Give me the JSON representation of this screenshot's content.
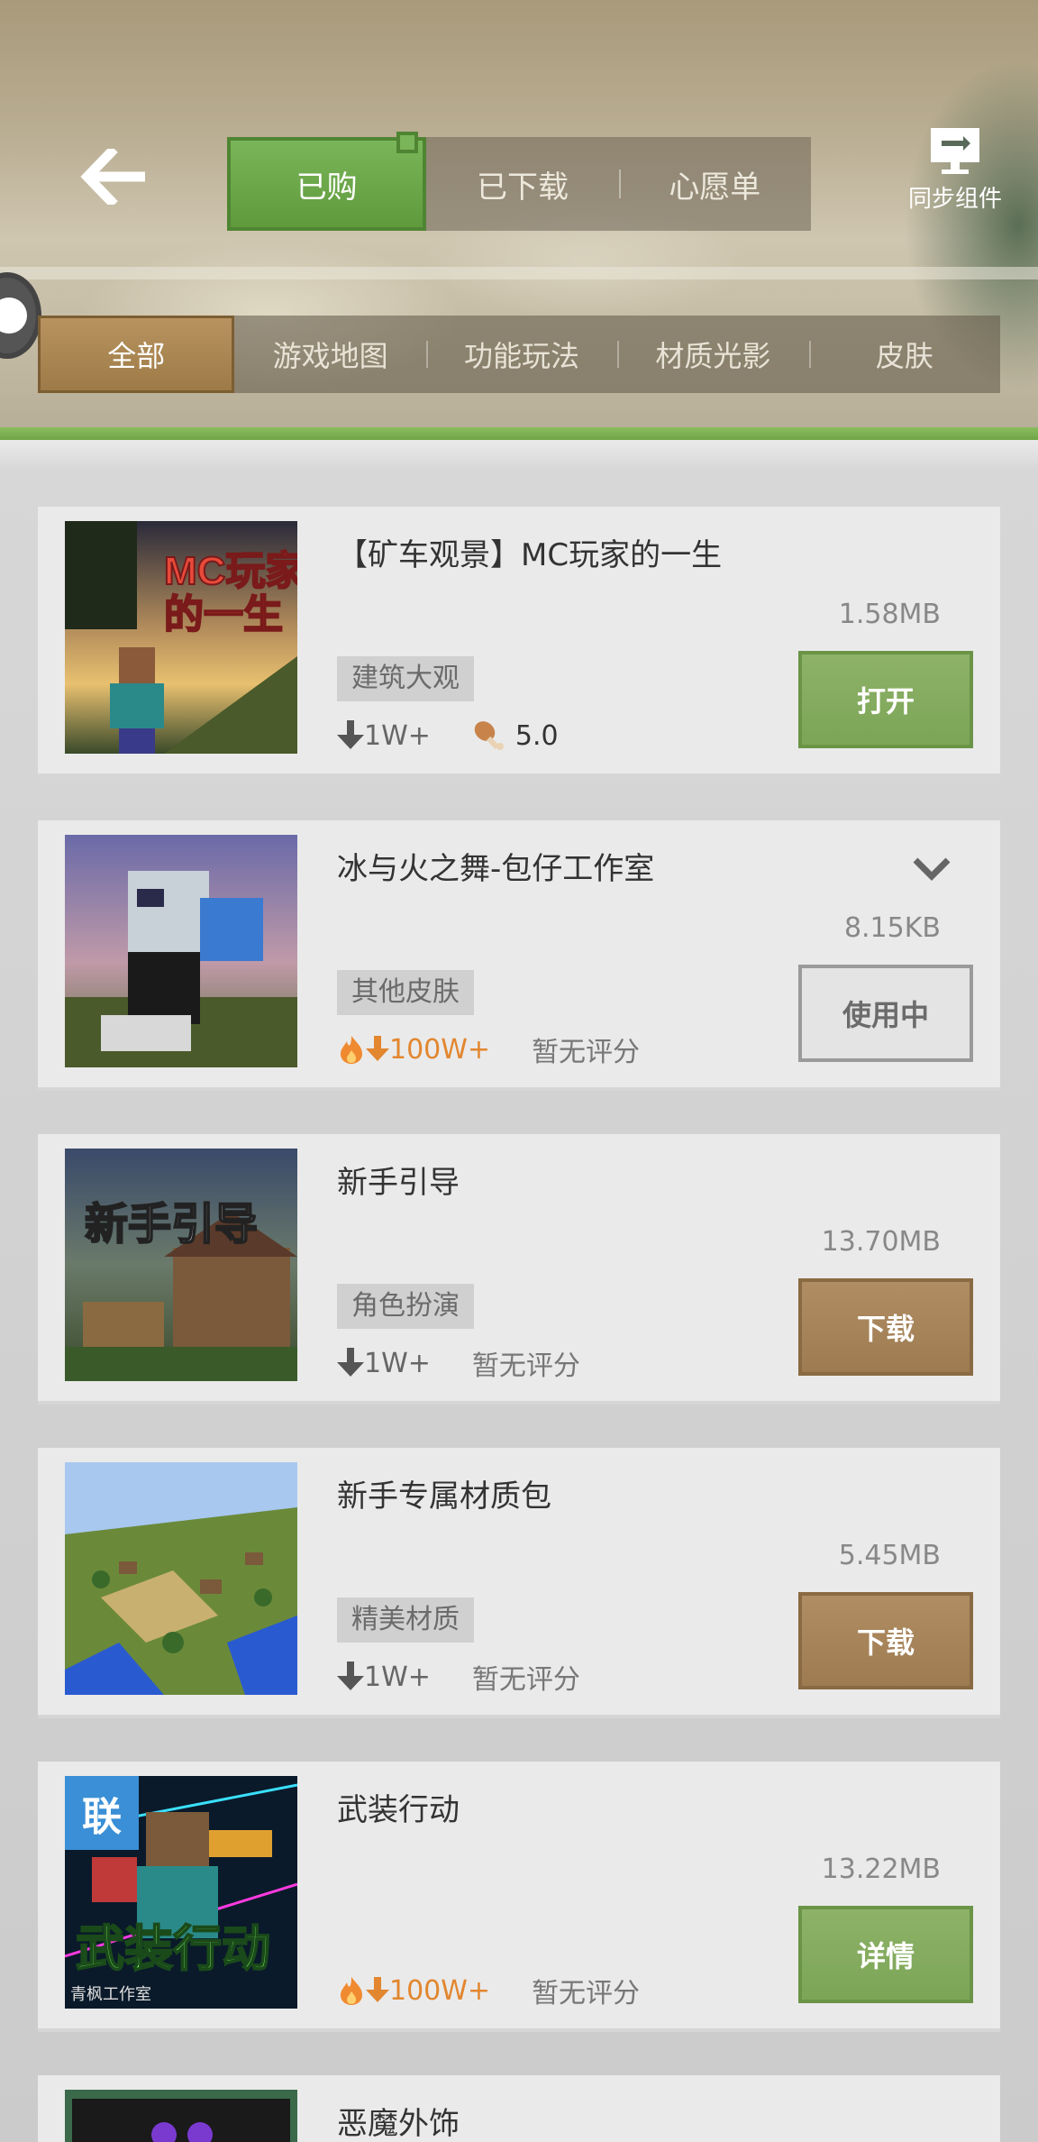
{
  "header": {
    "tabs": [
      {
        "label": "已购",
        "active": true
      },
      {
        "label": "已下载",
        "active": false
      },
      {
        "label": "心愿单",
        "active": false
      }
    ],
    "sync_label": "同步组件",
    "categories": [
      {
        "label": "全部",
        "active": true
      },
      {
        "label": "游戏地图",
        "active": false
      },
      {
        "label": "功能玩法",
        "active": false
      },
      {
        "label": "材质光影",
        "active": false
      },
      {
        "label": "皮肤",
        "active": false
      }
    ]
  },
  "items": [
    {
      "title": "【矿车观景】MC玩家的一生",
      "size": "1.58MB",
      "tag": "建筑大观",
      "downloads": "1W+",
      "hot": false,
      "rating": "5.0",
      "button": "打开",
      "button_style": "green",
      "thumb_text": "MC玩家\n的一生"
    },
    {
      "title": "冰与火之舞-包仔工作室",
      "size": "8.15KB",
      "tag": "其他皮肤",
      "downloads": "100W+",
      "hot": true,
      "rating": "暂无评分",
      "button": "使用中",
      "button_style": "using"
    },
    {
      "title": "新手引导",
      "size": "13.70MB",
      "tag": "角色扮演",
      "downloads": "1W+",
      "hot": false,
      "rating": "暂无评分",
      "button": "下载",
      "button_style": "brown",
      "thumb_text": "新手引导"
    },
    {
      "title": "新手专属材质包",
      "size": "5.45MB",
      "tag": "精美材质",
      "downloads": "1W+",
      "hot": false,
      "rating": "暂无评分",
      "button": "下载",
      "button_style": "brown"
    },
    {
      "title": "武装行动",
      "size": "13.22MB",
      "downloads": "100W+",
      "hot": true,
      "rating": "暂无评分",
      "button": "详情",
      "button_style": "green",
      "badge": "联",
      "thumb_text": "武装行动",
      "thumb_subtext": "青枫工作室"
    },
    {
      "title": "恶魔外饰"
    }
  ]
}
